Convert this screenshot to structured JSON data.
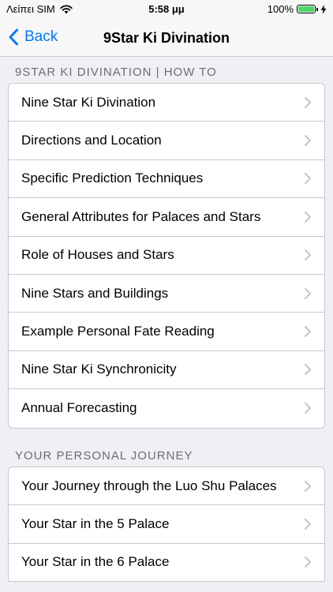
{
  "status_bar": {
    "carrier": "Λείπει SIM",
    "time": "5:58 μμ",
    "battery": "100%",
    "battery_level": 1.0
  },
  "nav": {
    "back_label": "Back",
    "title": "9Star Ki Divination"
  },
  "colors": {
    "accent": "#007aff",
    "background": "#efeff4",
    "section_header": "#6d6d72",
    "chevron": "#c7c7cc",
    "battery": "#4cd964"
  },
  "icons": {
    "back": "chevron-left-icon",
    "row": "chevron-right-icon",
    "wifi": "wifi-icon",
    "battery": "battery-icon",
    "charging": "charging-bolt-icon"
  },
  "sections": [
    {
      "header": "9STAR KI DIVINATION | HOW TO",
      "items": [
        "Nine Star Ki Divination",
        "Directions and Location",
        "Specific Prediction Techniques",
        "General Attributes for Palaces and Stars",
        "Role of Houses and Stars",
        "Nine Stars and Buildings",
        "Example Personal Fate Reading",
        "Nine Star Ki Synchronicity",
        "Annual Forecasting"
      ]
    },
    {
      "header": "YOUR PERSONAL JOURNEY",
      "items": [
        "Your Journey through the Luo Shu Palaces",
        "Your Star in the 5 Palace",
        "Your Star in the 6 Palace"
      ]
    }
  ]
}
